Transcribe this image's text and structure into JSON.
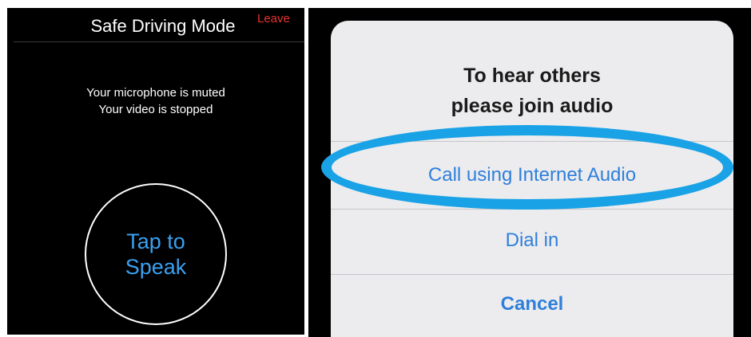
{
  "driving_mode": {
    "title": "Safe Driving Mode",
    "leave_label": "Leave",
    "mic_status": "Your microphone is muted",
    "video_status": "Your video is stopped",
    "speak_line1": "Tap to",
    "speak_line2": "Speak",
    "colors": {
      "leave": "#e8322f",
      "speak": "#3aa0f0"
    }
  },
  "audio_prompt": {
    "line1": "To hear others",
    "line2": "please join audio",
    "options": {
      "internet_audio": "Call using Internet Audio",
      "dial_in": "Dial in",
      "cancel": "Cancel"
    },
    "colors": {
      "option": "#2f7fdb",
      "highlight": "#1aa2e6"
    }
  }
}
